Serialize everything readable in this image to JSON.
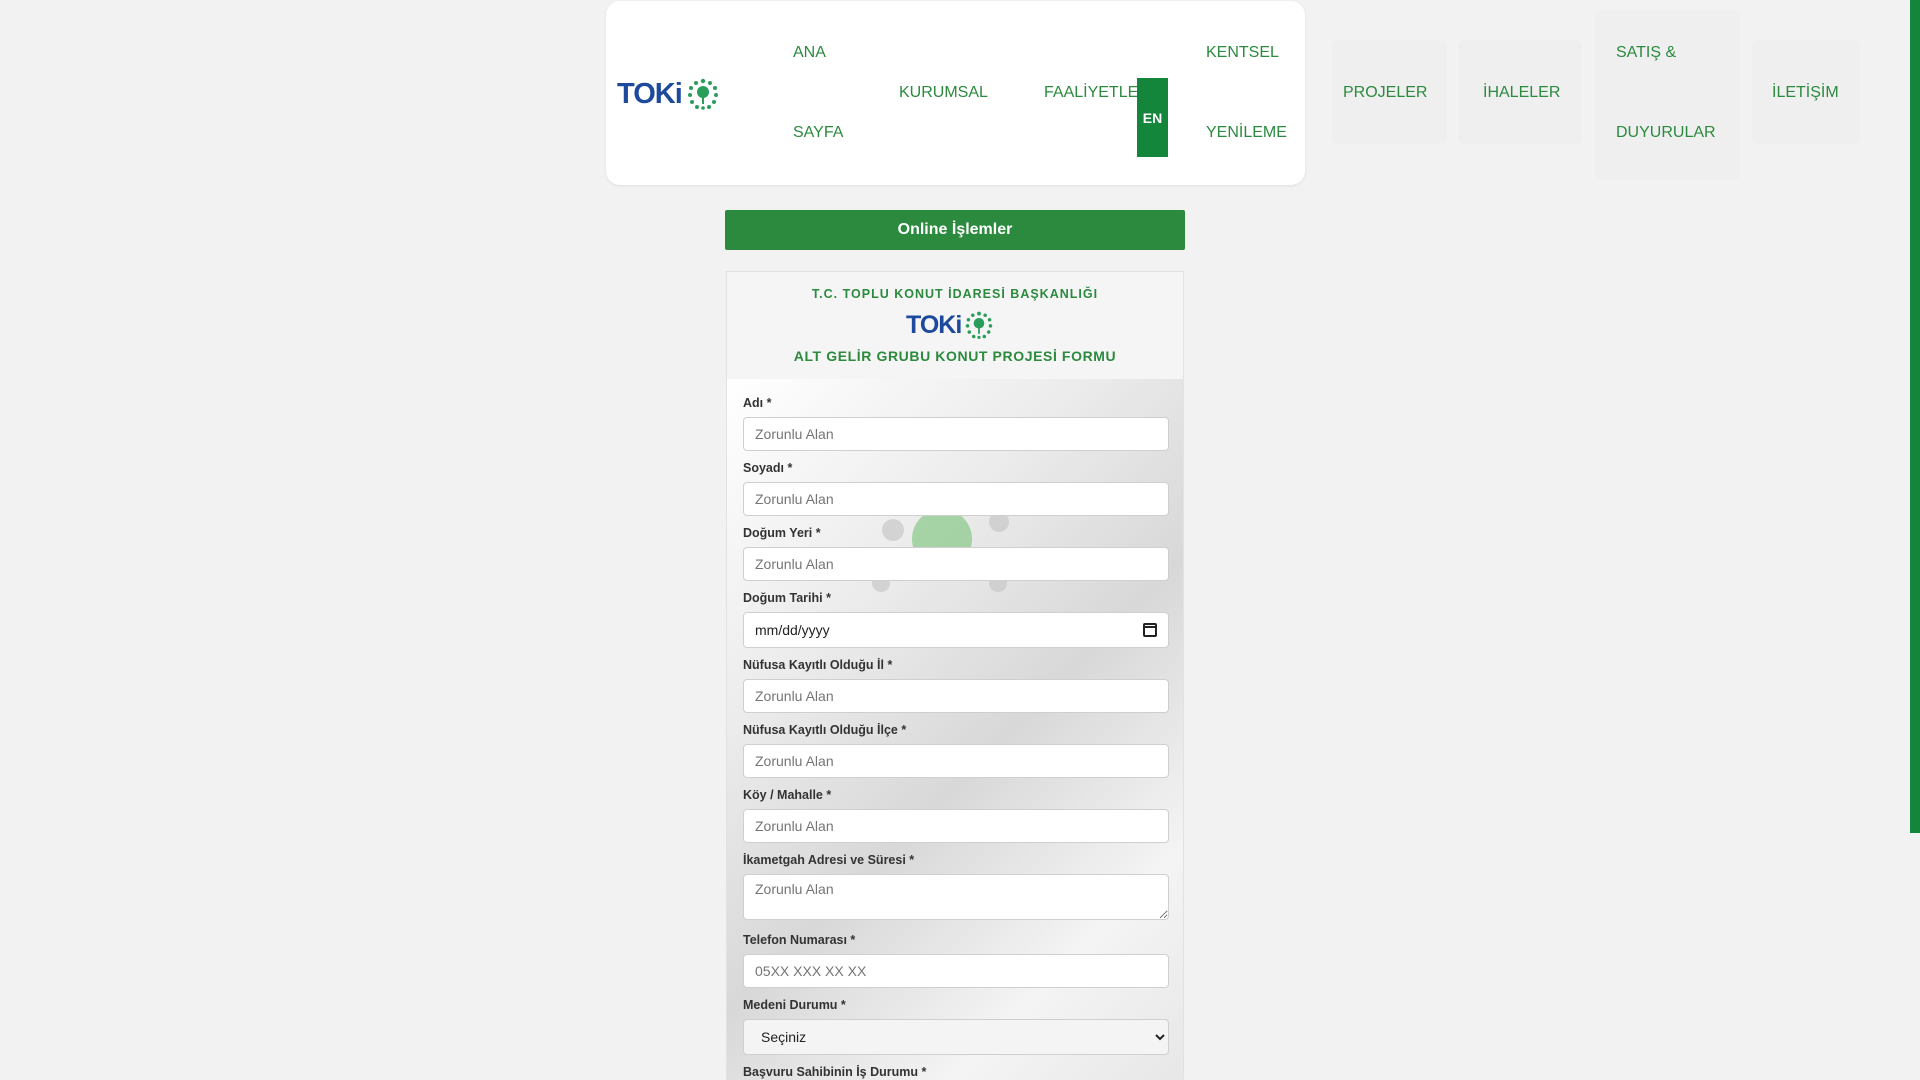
{
  "nav": {
    "logo_text": "TOKi",
    "items": [
      {
        "line1": "ANA",
        "line2": "SAYFA"
      },
      {
        "label": "KURUMSAL"
      },
      {
        "label": "FAALİYETLER"
      },
      {
        "line1": "KENTSEL",
        "line2": "YENİLEME"
      },
      {
        "label": "PROJELER"
      },
      {
        "label": "İHALELER"
      },
      {
        "line1": "SATIŞ &",
        "line2": "DUYURULAR"
      },
      {
        "label": "İLETİŞİM"
      }
    ],
    "lang_button": "EN"
  },
  "online_bar": "Online İşlemler",
  "form": {
    "org": "T.C. TOPLU KONUT İDARESİ BAŞKANLIĞI",
    "logo_text": "TOKi",
    "title": "ALT GELİR GRUBU KONUT PROJESİ FORMU",
    "fields": [
      {
        "label": "Adı *",
        "placeholder": "Zorunlu Alan"
      },
      {
        "label": "Soyadı *",
        "placeholder": "Zorunlu Alan"
      },
      {
        "label": "Doğum Yeri *",
        "placeholder": "Zorunlu Alan"
      },
      {
        "label": "Doğum Tarihi *",
        "placeholder": "mm/dd/yyyy"
      },
      {
        "label": "Nüfusa Kayıtlı Olduğu İl *",
        "placeholder": "Zorunlu Alan"
      },
      {
        "label": "Nüfusa Kayıtlı Olduğu İlçe *",
        "placeholder": "Zorunlu Alan"
      },
      {
        "label": "Köy / Mahalle *",
        "placeholder": "Zorunlu Alan"
      },
      {
        "label": "İkametgah Adresi ve Süresi *",
        "placeholder": "Zorunlu Alan"
      },
      {
        "label": "Telefon Numarası *",
        "placeholder": "05XX XXX XX XX"
      },
      {
        "label": "Medeni Durumu *",
        "selected": "Seçiniz"
      },
      {
        "label": "Başvuru Sahibinin İş Durumu *"
      }
    ]
  },
  "colors": {
    "brand_green": "#2b8a3e",
    "dark_green": "#14863c",
    "logo_blue": "#1d4a9c"
  }
}
